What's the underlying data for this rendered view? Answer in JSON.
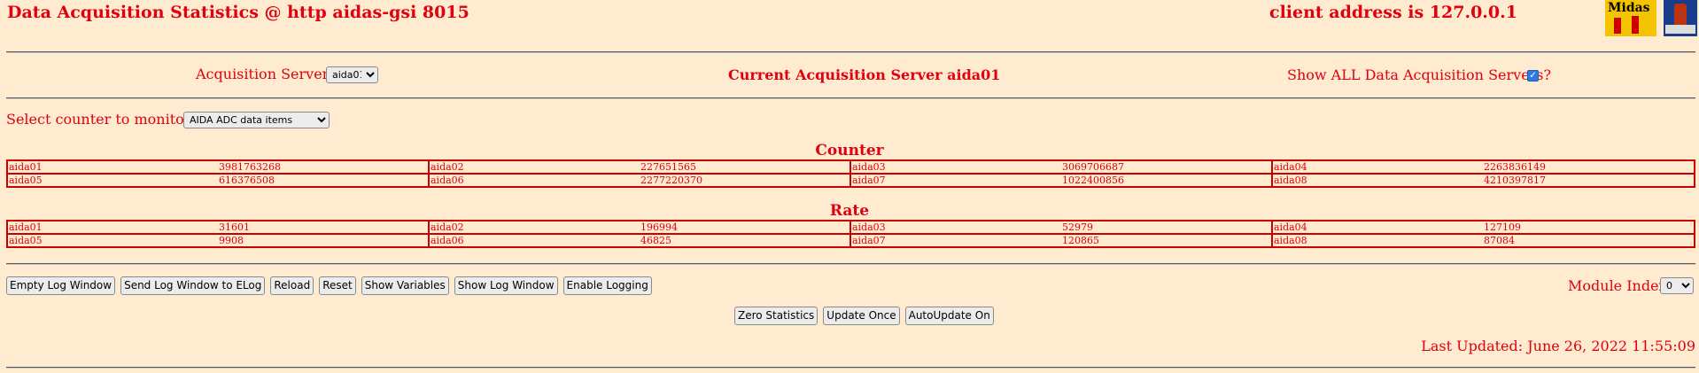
{
  "header": {
    "title": "Data Acquisition Statistics @ http aidas-gsi 8015",
    "client_address": "client address is 127.0.0.1",
    "logo_text": "Midas"
  },
  "servers": {
    "label": "Acquisition Servers",
    "selected": "aida01",
    "current_label": "Current Acquisition Server aida01",
    "show_all_label": "Show ALL Data Acquisition Servers?",
    "show_all_checked": true
  },
  "counter_select": {
    "label": "Select counter to monitor",
    "selected": "AIDA ADC data items"
  },
  "counter": {
    "title": "Counter",
    "rows": [
      [
        {
          "name": "aida01",
          "value": "3981763268"
        },
        {
          "name": "aida02",
          "value": "227651565"
        },
        {
          "name": "aida03",
          "value": "3069706687"
        },
        {
          "name": "aida04",
          "value": "2263836149"
        }
      ],
      [
        {
          "name": "aida05",
          "value": "616376508"
        },
        {
          "name": "aida06",
          "value": "2277220370"
        },
        {
          "name": "aida07",
          "value": "1022400856"
        },
        {
          "name": "aida08",
          "value": "4210397817"
        }
      ]
    ]
  },
  "rate": {
    "title": "Rate",
    "rows": [
      [
        {
          "name": "aida01",
          "value": "31601"
        },
        {
          "name": "aida02",
          "value": "196994"
        },
        {
          "name": "aida03",
          "value": "52979"
        },
        {
          "name": "aida04",
          "value": "127109"
        }
      ],
      [
        {
          "name": "aida05",
          "value": "9908"
        },
        {
          "name": "aida06",
          "value": "46825"
        },
        {
          "name": "aida07",
          "value": "120865"
        },
        {
          "name": "aida08",
          "value": "87084"
        }
      ]
    ]
  },
  "buttons": {
    "empty_log": "Empty Log Window",
    "send_log": "Send Log Window to ELog",
    "reload": "Reload",
    "reset": "Reset",
    "show_variables": "Show Variables",
    "show_log": "Show Log Window",
    "enable_logging": "Enable Logging",
    "zero_stats": "Zero Statistics",
    "update_once": "Update Once",
    "autoupdate": "AutoUpdate On"
  },
  "module_index": {
    "label": "Module Index",
    "selected": "0"
  },
  "last_updated": "Last Updated: June 26, 2022 11:55:09",
  "colors": {
    "background": "#feebd0",
    "text": "#e0000f",
    "table_border": "#cc0000"
  }
}
